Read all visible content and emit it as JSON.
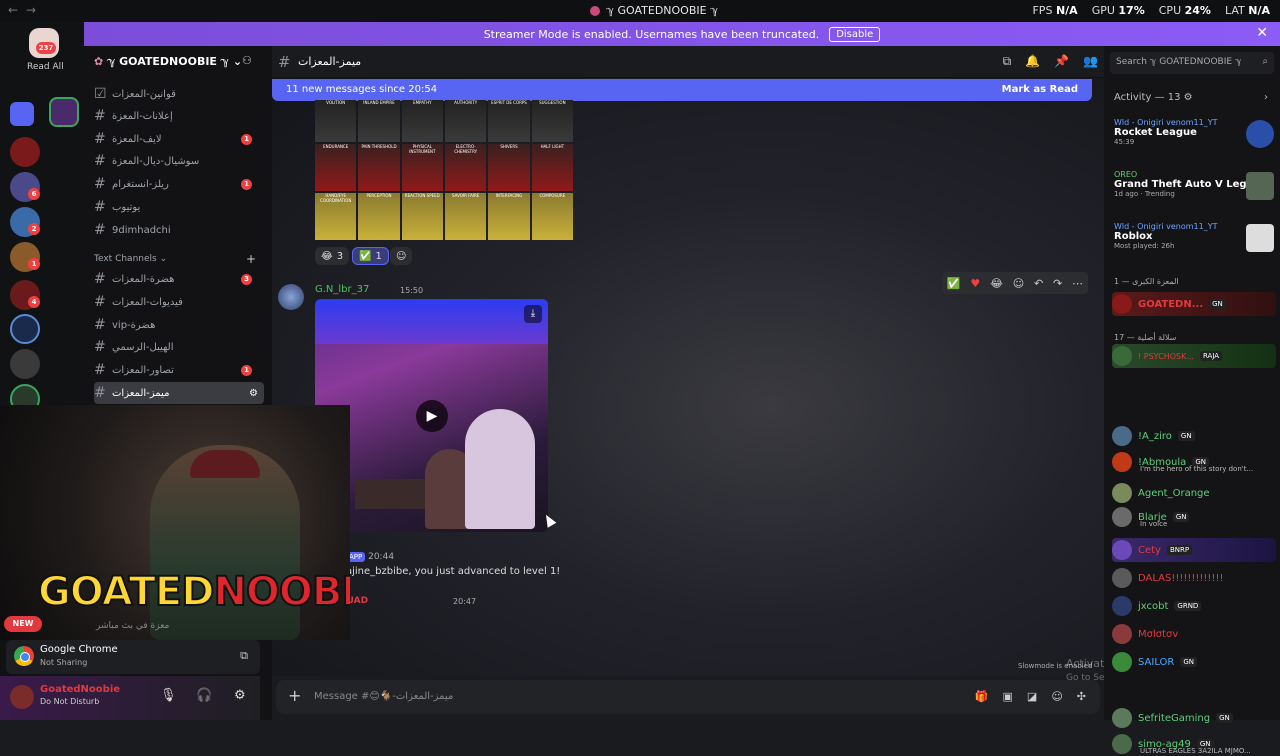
{
  "titlebar": {
    "title": "ℽ GOATEDNOOBIE ℽ",
    "stats": [
      {
        "label": "FPS",
        "value": "N/A"
      },
      {
        "label": "GPU",
        "value": "17%"
      },
      {
        "label": "CPU",
        "value": "24%"
      },
      {
        "label": "LAT",
        "value": "N/A"
      }
    ]
  },
  "rail": {
    "read_all": "Read All",
    "badge": "237"
  },
  "banner": {
    "text": "Streamer Mode is enabled. Usernames have been truncated.",
    "button": "Disable"
  },
  "server": {
    "name": "ℽ GOATEDNOOBIE ℽ"
  },
  "channels": [
    {
      "label": "قوانين-المعزات",
      "badge": ""
    },
    {
      "label": "إعلانات-المعزة",
      "badge": ""
    },
    {
      "label": "لايف-المعزة",
      "badge": "1"
    },
    {
      "label": "سوشيال-ديال-المعزة",
      "badge": ""
    },
    {
      "label": "ريلز-انستغرام",
      "badge": "1"
    },
    {
      "label": "يوتيوب",
      "badge": ""
    },
    {
      "label": "9dimhadchi",
      "badge": ""
    }
  ],
  "text_channels_label": "Text Channels",
  "text_channels": [
    {
      "label": "هضرة-المعزات",
      "badge": "3"
    },
    {
      "label": "فيديوات-المعزات",
      "badge": ""
    },
    {
      "label": "هضرة-vip",
      "badge": ""
    },
    {
      "label": "الهيبل-الرسمي",
      "badge": ""
    },
    {
      "label": "تصاور-المعزات",
      "badge": "1"
    },
    {
      "label": "ميمز-المعزات",
      "badge": ""
    }
  ],
  "webcam": {
    "logo_left": "GOATED",
    "logo_right": "NOOBIE",
    "new_badge": "NEW"
  },
  "chrome": {
    "name": "Google Chrome",
    "status": "Not Sharing"
  },
  "user": {
    "name": "GoatedNoobie",
    "status": "Do Not Disturb"
  },
  "chat_header": {
    "channel": "ميمز-المعزات"
  },
  "new_messages": {
    "text": "11 new messages since 20:54",
    "action": "Mark as Read"
  },
  "grid_labels": [
    "VOLITION",
    "INLAND EMPIRE",
    "EMPATHY",
    "AUTHORITY",
    "ESPRIT DE CORPS",
    "SUGGESTION",
    "ENDURANCE",
    "PAIN THRESHOLD",
    "PHYSICAL INSTRUMENT",
    "ELECTRO-CHEMISTRY",
    "SHIVERS",
    "HALF LIGHT",
    "HAND/EYE COORDINATION",
    "PERCEPTION",
    "REACTION SPEED",
    "SAVOIR FAIRE",
    "INTERFACING",
    "COMPOSURE"
  ],
  "reactions": [
    {
      "emoji": "😂",
      "count": "3"
    },
    {
      "emoji": "✅",
      "count": "1"
    }
  ],
  "message": {
    "author": "G.N_lbr_37",
    "time": "15:50"
  },
  "app_message": {
    "tag": "APP",
    "time": "20:44",
    "text": "ajine_bzbibe, you just advanced to level 1!"
  },
  "mouad": {
    "author": "MOUAD",
    "time": "20:47"
  },
  "live_line": "معزة في بث مباشر",
  "composer": {
    "placeholder": "Message #😊🐐-ميمز-المعزات"
  },
  "slowmode": "Slowmode is enabled",
  "activate": {
    "title": "Activate Windows",
    "sub": "Go to Settings to activate Windows."
  },
  "right": {
    "search_placeholder": "Search ℽ GOATEDNOOBIE ℽ",
    "activity_label": "Activity — 13",
    "activities": [
      {
        "user": "Wld - Onigiri venom11_YT",
        "game": "Rocket League",
        "status": "45:39"
      },
      {
        "user": "OREO",
        "game": "Grand Theft Auto V Legacy",
        "status": "1d ago · Trending"
      },
      {
        "user": "Wld - Onigiri venom11_YT",
        "game": "Roblox",
        "status": "Most played: 26h"
      }
    ],
    "group1": "المعزة الكبرى — 1",
    "group2": "سلالة أصلية — 17",
    "members": [
      {
        "name": "GOATEDN...",
        "tag": "GN",
        "sub": ""
      },
      {
        "name": "! PSYCHOSK...",
        "tag": "RAJA",
        "sub": ""
      },
      {
        "name": "!A_ziro",
        "tag": "GN",
        "sub": ""
      },
      {
        "name": "!Abmoula",
        "tag": "GN",
        "sub": "I'm the hero of this story don't..."
      },
      {
        "name": "Agent_Orange",
        "tag": "",
        "sub": ""
      },
      {
        "name": "Blarje",
        "tag": "GN",
        "sub": "In voice"
      },
      {
        "name": "Cety",
        "tag": "BNRP",
        "sub": ""
      },
      {
        "name": "DALAS!!!!!!!!!!!!!",
        "tag": "",
        "sub": ""
      },
      {
        "name": "jxcobt",
        "tag": "GRND",
        "sub": ""
      },
      {
        "name": "Mσlσtσv",
        "tag": "",
        "sub": ""
      },
      {
        "name": "SAILOR",
        "tag": "GN",
        "sub": ""
      },
      {
        "name": "SefriteGaming",
        "tag": "GN",
        "sub": ""
      },
      {
        "name": "simo-ag49",
        "tag": "GN",
        "sub": "ULTRAS EAGLES 3A2ILA MJMO..."
      }
    ]
  }
}
